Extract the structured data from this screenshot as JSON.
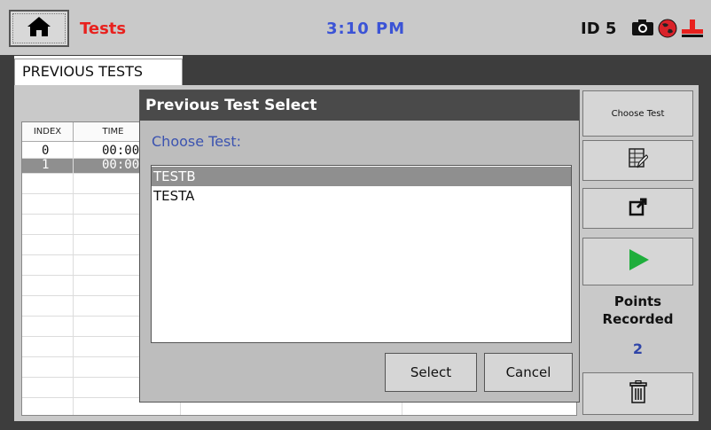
{
  "header": {
    "title": "Tests",
    "time": "3:10 PM",
    "device_id": "ID 5",
    "icons": [
      "home-icon",
      "camera-icon",
      "globe-icon",
      "sensor-icon"
    ]
  },
  "tab": {
    "label": "PREVIOUS TESTS"
  },
  "table": {
    "columns": [
      "INDEX",
      "TIME"
    ],
    "rows": [
      {
        "index": "0",
        "time": "00:00:"
      },
      {
        "index": "1",
        "time": "00:00:"
      }
    ]
  },
  "sidebar": {
    "choose_test_label": "Choose Test",
    "icons": [
      "table-edit-icon",
      "export-icon",
      "play-icon",
      "trash-icon"
    ],
    "points_label_1": "Points",
    "points_label_2": "Recorded",
    "points_value": "2"
  },
  "dialog": {
    "title": "Previous Test Select",
    "prompt": "Choose Test:",
    "items": [
      {
        "label": "TESTB",
        "selected": true
      },
      {
        "label": "TESTA",
        "selected": false
      }
    ],
    "select_label": "Select",
    "cancel_label": "Cancel"
  },
  "colors": {
    "title_red": "#e8211e",
    "time_blue": "#3b53d6",
    "play_green": "#1fae3c",
    "selection_gray": "#8f8f8f"
  }
}
